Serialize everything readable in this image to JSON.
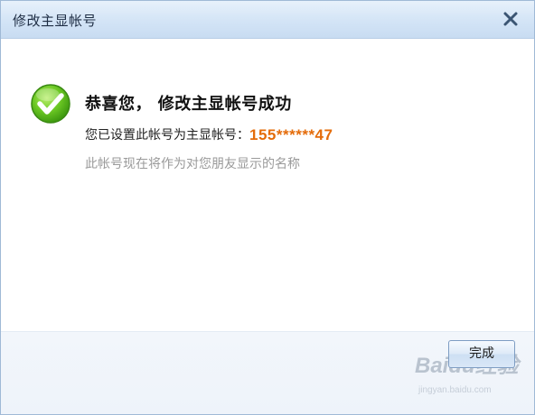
{
  "dialog": {
    "title": "修改主显帐号",
    "close_icon": "close-icon"
  },
  "message": {
    "icon": "check-circle-icon",
    "heading": "恭喜您， 修改主显帐号成功",
    "line1_prefix": "您已设置此帐号为主显帐号：",
    "account": "155******47",
    "line2": "此帐号现在将作为对您朋友显示的名称"
  },
  "footer": {
    "done_label": "完成"
  },
  "watermark": {
    "brand": "Baidu经验",
    "url": "jingyan.baidu.com"
  },
  "colors": {
    "accent": "#e46c0a",
    "titlebar": "#d3e4f6",
    "check_green": "#5fbf1d"
  }
}
